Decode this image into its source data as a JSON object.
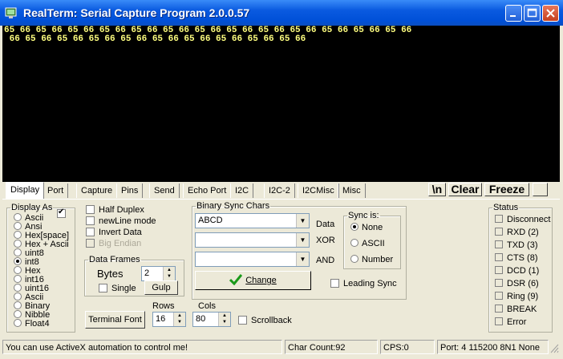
{
  "window": {
    "title": "RealTerm: Serial Capture Program 2.0.0.57",
    "minimize": "_",
    "maximize": "□",
    "close": "✕"
  },
  "terminal": {
    "lines": [
      "65 66 65 66 65 66 65 66 65 66 65 66 65 66 65 66 65 66 65 66 65 66 65 66 65 66",
      " 66 65 66 65 66 65 66 65 66 65 66 65 66 65 66 65 66 65 66"
    ]
  },
  "tabs": [
    "Display",
    "Port",
    "Capture",
    "Pins",
    "Send",
    "Echo Port",
    "I2C",
    "I2C-2",
    "I2CMisc",
    "Misc"
  ],
  "toolbar": {
    "newline": "\\n",
    "clear": "Clear",
    "freeze": "Freeze"
  },
  "display_as": {
    "legend": "Display As",
    "options": [
      "Ascii",
      "Ansi",
      "Hex[space]",
      "Hex + Ascii",
      "uint8",
      "int8",
      "Hex",
      "int16",
      "uint16",
      "Ascii",
      "Binary",
      "Nibble",
      "Float4"
    ],
    "selected": "int8"
  },
  "options": {
    "half_duplex": "Half Duplex",
    "newline_mode": "newLine mode",
    "invert_data": "Invert Data",
    "big_endian": "Big Endian"
  },
  "data_frames": {
    "legend": "Data Frames",
    "bytes_label": "Bytes",
    "bytes_value": "2",
    "single": "Single",
    "gulp": "Gulp"
  },
  "binary_sync": {
    "legend": "Binary Sync Chars",
    "value1": "ABCD",
    "data": "Data",
    "xor": "XOR",
    "and": "AND",
    "change": "Change",
    "leading_sync": "Leading Sync"
  },
  "sync_is": {
    "legend": "Sync is:",
    "options": [
      "None",
      "ASCII",
      "Number"
    ],
    "selected": "None"
  },
  "terminal_font": "Terminal Font",
  "rows": {
    "label": "Rows",
    "value": "16"
  },
  "cols": {
    "label": "Cols",
    "value": "80"
  },
  "scrollback": "Scrollback",
  "status": {
    "legend": "Status",
    "items": [
      "Disconnect",
      "RXD (2)",
      "TXD (3)",
      "CTS (8)",
      "DCD (1)",
      "DSR (6)",
      "Ring (9)",
      "BREAK",
      "Error"
    ]
  },
  "statusbar": {
    "message": "You can use ActiveX automation to control me!",
    "char_count": "Char Count:92",
    "cps": "CPS:0",
    "port": "Port: 4 115200 8N1 None"
  },
  "colors": {
    "terminal_bg": "#000000",
    "terminal_fg": "#ffff80",
    "titlebar": "#0a5ae0"
  }
}
